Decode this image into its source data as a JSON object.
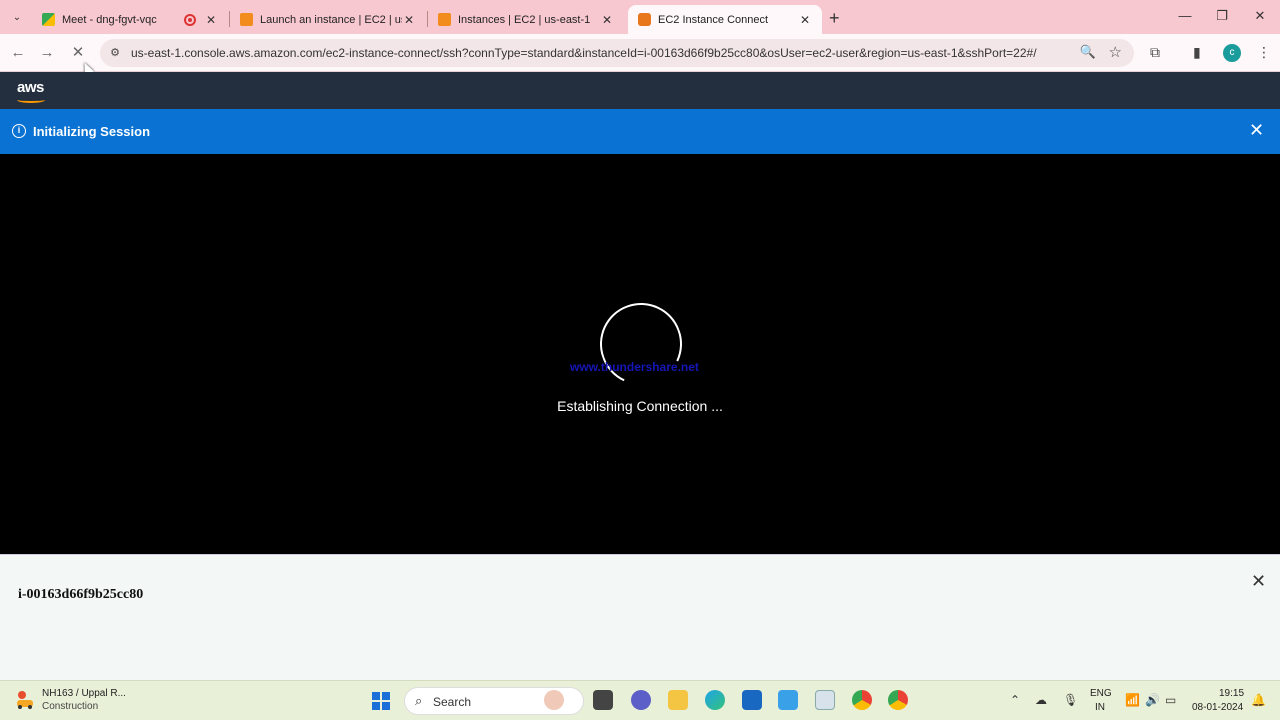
{
  "browser": {
    "tabs": [
      {
        "title": "Meet - dng-fgvt-vqc",
        "active": false
      },
      {
        "title": "Launch an instance | EC2 | us-e",
        "active": false
      },
      {
        "title": "Instances | EC2 | us-east-1",
        "active": false
      },
      {
        "title": "EC2 Instance Connect",
        "active": true
      }
    ],
    "url": "us-east-1.console.aws.amazon.com/ec2-instance-connect/ssh?connType=standard&instanceId=i-00163d66f9b25cc80&osUser=ec2-user&region=us-east-1&sshPort=22#/",
    "profile_initial": "c"
  },
  "aws": {
    "logo": "aws",
    "banner_message": "Initializing Session"
  },
  "terminal": {
    "watermark": "www.thundershare.net",
    "status": "Establishing Connection ..."
  },
  "panel": {
    "instance_id": "i-00163d66f9b25cc80"
  },
  "taskbar": {
    "weather_title": "NH163 / Uppal R...",
    "weather_subtitle": "Construction",
    "search_label": "Search",
    "lang_line1": "ENG",
    "lang_line2": "IN",
    "time": "19:15",
    "date": "08-01-2024"
  },
  "colors": {
    "tabstrip": "#f8c8d0",
    "aws_header": "#232f3e",
    "banner": "#0972d3",
    "taskbar": "#e9f0d8"
  }
}
